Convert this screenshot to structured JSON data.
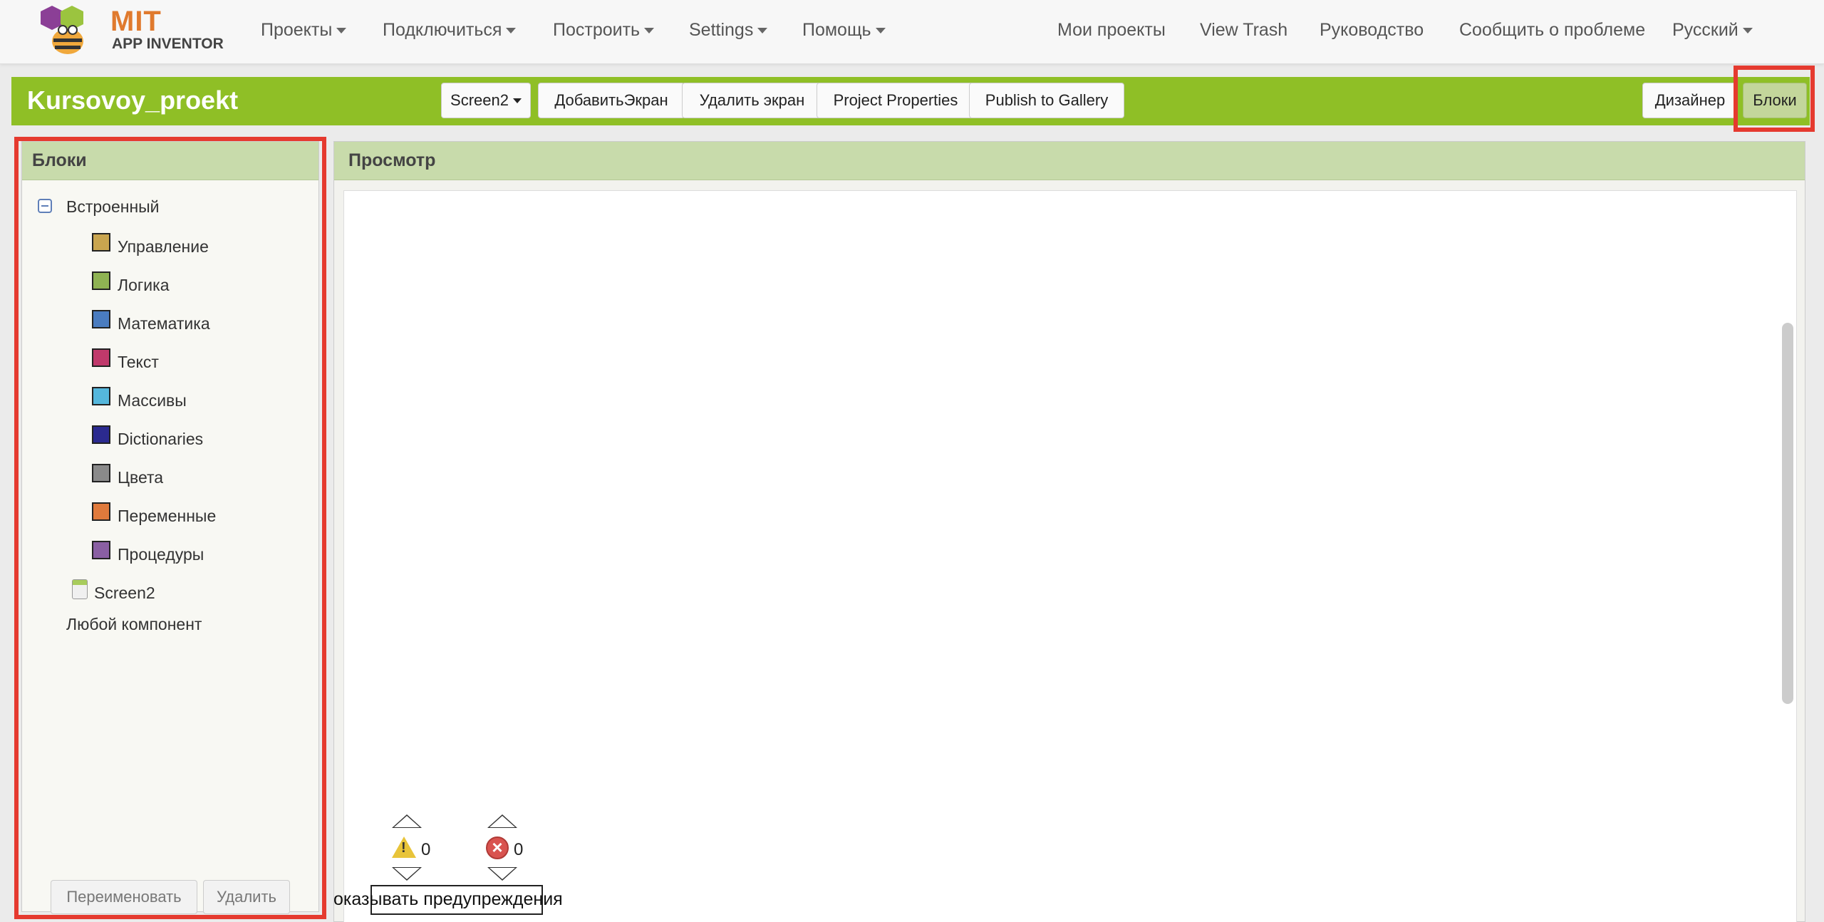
{
  "nav": {
    "logo_top": "MIT",
    "logo_bottom": "APP INVENTOR",
    "projects": "Проекты",
    "connect": "Подключиться",
    "build": "Построить",
    "settings": "Settings",
    "help": "Помощь",
    "my_projects": "Мои проекты",
    "view_trash": "View Trash",
    "guide": "Руководство",
    "report": "Сообщить о проблеме",
    "language": "Русский"
  },
  "toolbar": {
    "project_name": "Kursovoy_proekt",
    "screen_select": "Screen2",
    "add_screen": "ДобавитьЭкран",
    "remove_screen": "Удалить экран",
    "project_properties": "Project Properties",
    "publish": "Publish to Gallery",
    "designer": "Дизайнер",
    "blocks": "Блоки"
  },
  "blocks_panel": {
    "title": "Блоки",
    "builtin": "Встроенный",
    "categories": [
      {
        "label": "Управление",
        "color": "#c9a54f"
      },
      {
        "label": "Логика",
        "color": "#8fb353"
      },
      {
        "label": "Математика",
        "color": "#4a7cc0"
      },
      {
        "label": "Текст",
        "color": "#c0396b"
      },
      {
        "label": "Массивы",
        "color": "#55b7dc"
      },
      {
        "label": "Dictionaries",
        "color": "#2b2a8f"
      },
      {
        "label": "Цвета",
        "color": "#8a8a8a"
      },
      {
        "label": "Переменные",
        "color": "#e07a3c"
      },
      {
        "label": "Процедуры",
        "color": "#8a5fa3"
      }
    ],
    "screen": "Screen2",
    "any_component": "Любой компонент",
    "rename": "Переименовать",
    "delete": "Удалить"
  },
  "viewer": {
    "title": "Просмотр",
    "warnings_count": "0",
    "errors_count": "0",
    "show_warnings": "оказывать предупреждения"
  }
}
